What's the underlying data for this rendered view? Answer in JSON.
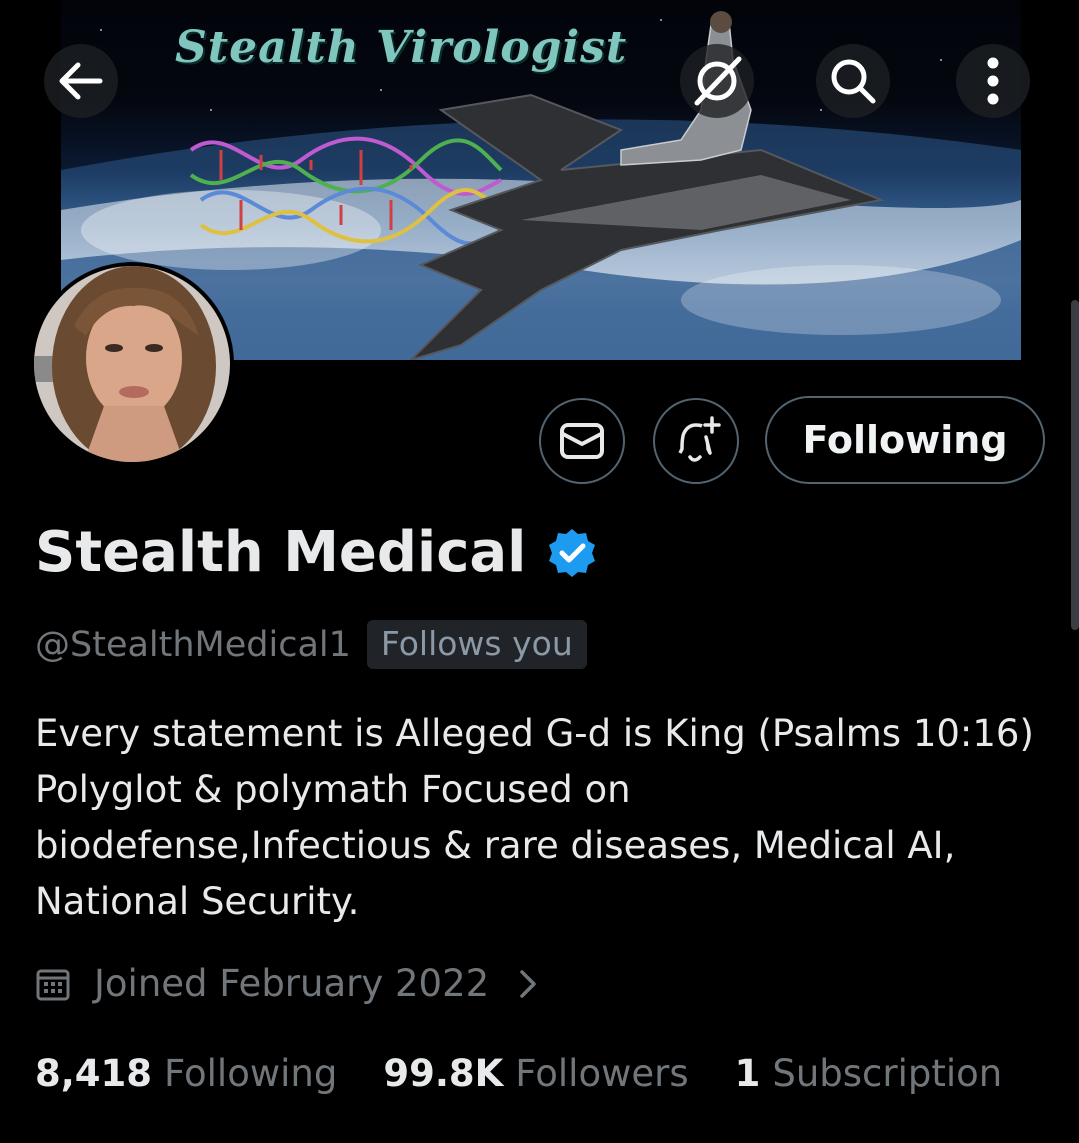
{
  "header": {
    "back_icon": "arrow-left-icon",
    "grok_icon": "grok-icon",
    "search_icon": "search-icon",
    "more_icon": "more-vertical-icon"
  },
  "banner": {
    "title": "Stealth Virologist"
  },
  "actions": {
    "message_icon": "envelope-icon",
    "notify_icon": "bell-plus-icon",
    "follow_label": "Following"
  },
  "profile": {
    "display_name": "Stealth Medical",
    "verified_icon": "verified-badge-icon",
    "handle": "@StealthMedical1",
    "follows_you": "Follows you",
    "bio": "Every statement is Alleged G-d is King (Psalms 10:16) Polyglot & polymath Focused on biodefense,Infectious & rare diseases, Medical AI, National Security.",
    "joined": "Joined February 2022"
  },
  "stats": {
    "following_count": "8,418",
    "following_label": "Following",
    "followers_count": "99.8K",
    "followers_label": "Followers",
    "subscription_count": "1",
    "subscription_label": "Subscription"
  },
  "colors": {
    "background": "#000000",
    "text_primary": "#e7e9ea",
    "text_secondary": "#71767b",
    "border": "#536471",
    "verified_blue": "#1d9bf0",
    "banner_title": "#7ec6be"
  }
}
